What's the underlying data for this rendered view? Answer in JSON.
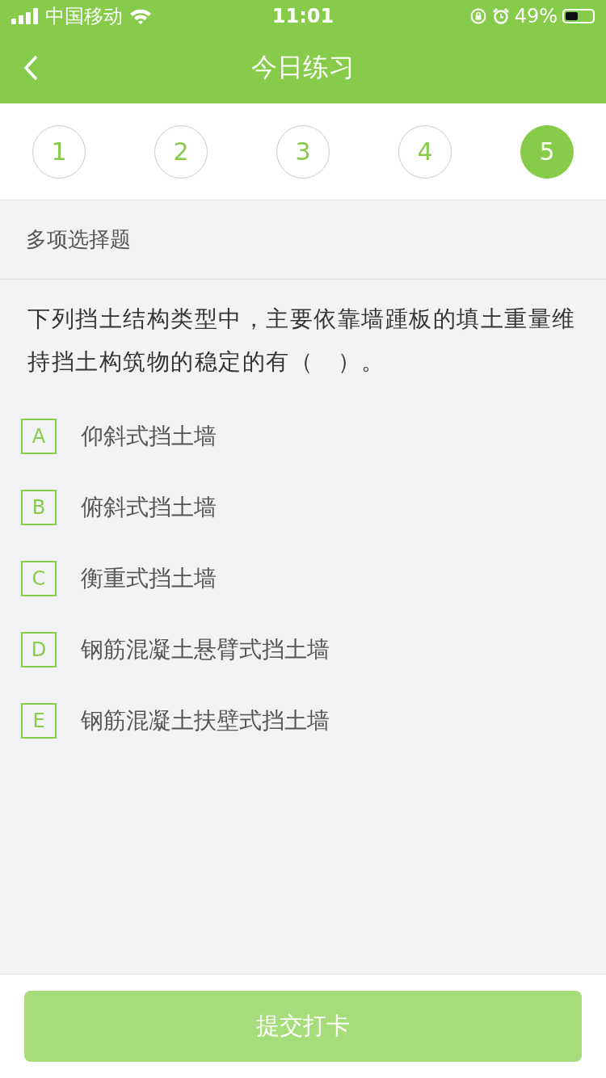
{
  "status_bar": {
    "carrier": "中国移动",
    "time": "11:01",
    "battery_text": "49%"
  },
  "nav": {
    "title": "今日练习"
  },
  "steps": [
    {
      "label": "1",
      "selected": false
    },
    {
      "label": "2",
      "selected": false
    },
    {
      "label": "3",
      "selected": false
    },
    {
      "label": "4",
      "selected": false
    },
    {
      "label": "5",
      "selected": true
    }
  ],
  "question": {
    "type_label": "多项选择题",
    "text": "下列挡土结构类型中，主要依靠墙踵板的填土重量维持挡土构筑物的稳定的有（　）。",
    "options": [
      {
        "letter": "A",
        "text": "仰斜式挡土墙",
        "selected": false
      },
      {
        "letter": "B",
        "text": "俯斜式挡土墙",
        "selected": false
      },
      {
        "letter": "C",
        "text": "衡重式挡土墙",
        "selected": false
      },
      {
        "letter": "D",
        "text": "钢筋混凝土悬臂式挡土墙",
        "selected": false
      },
      {
        "letter": "E",
        "text": "钢筋混凝土扶壁式挡土墙",
        "selected": false
      }
    ]
  },
  "submit": {
    "label": "提交打卡",
    "disabled": true
  }
}
